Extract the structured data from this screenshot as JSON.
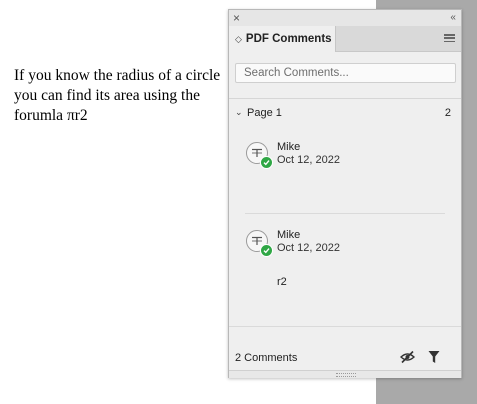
{
  "document": {
    "text": "If you know the radius of a circle you can find its area using the forumla πr2"
  },
  "panel": {
    "title_tab": "PDF Comments",
    "search_placeholder": "Search Comments...",
    "page_group": {
      "label": "Page 1",
      "count": "2"
    },
    "comments": [
      {
        "author": "Mike",
        "date": "Oct 12, 2022",
        "body": ""
      },
      {
        "author": "Mike",
        "date": "Oct 12, 2022",
        "body": "r2"
      }
    ],
    "footer": {
      "count_label": "2 Comments"
    },
    "icons": {
      "close": "close-icon",
      "collapse": "double-chevron-icon",
      "menu": "hamburger-menu-icon",
      "tab_chevron": "updown-chevron-icon",
      "page_chevron": "chevron-down-icon",
      "avatar": "text-comment-icon",
      "status": "checkmark-icon",
      "hide": "eye-slash-icon",
      "filter": "filter-icon"
    },
    "colors": {
      "panel_bg": "#efefef",
      "status_green": "#2fa745",
      "gutter": "#a9a9a9"
    }
  }
}
